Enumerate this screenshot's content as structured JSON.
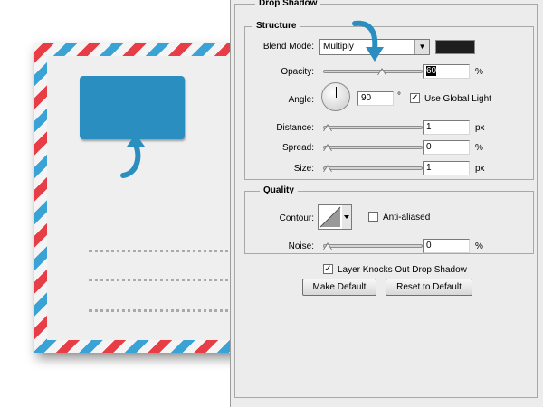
{
  "dialog": {
    "title": "Drop Shadow",
    "structure": {
      "title": "Structure",
      "blend_mode_label": "Blend Mode:",
      "blend_mode_value": "Multiply",
      "shadow_color": "#1e1e1e",
      "opacity_label": "Opacity:",
      "opacity_value": "60",
      "opacity_unit": "%",
      "angle_label": "Angle:",
      "angle_value": "90",
      "angle_unit": "°",
      "use_global_light_label": "Use Global Light",
      "use_global_light_checked": true,
      "distance_label": "Distance:",
      "distance_value": "1",
      "distance_unit": "px",
      "spread_label": "Spread:",
      "spread_value": "0",
      "spread_unit": "%",
      "size_label": "Size:",
      "size_value": "1",
      "size_unit": "px"
    },
    "quality": {
      "title": "Quality",
      "contour_label": "Contour:",
      "anti_aliased_label": "Anti-aliased",
      "anti_aliased_checked": false,
      "noise_label": "Noise:",
      "noise_value": "0",
      "noise_unit": "%"
    },
    "layer_knocks_out_label": "Layer Knocks Out Drop Shadow",
    "layer_knocks_out_checked": true,
    "make_default_label": "Make Default",
    "reset_default_label": "Reset to Default"
  },
  "sliders": {
    "opacity_fraction": 0.6,
    "distance_fraction": 0,
    "spread_fraction": 0,
    "size_fraction": 0,
    "noise_fraction": 0
  },
  "colors": {
    "airmail_red": "#e63d46",
    "airmail_blue": "#3aa3d6",
    "stamp": "#2a8fc0",
    "arrow": "#2a8fc0"
  },
  "check_mark": "✓"
}
